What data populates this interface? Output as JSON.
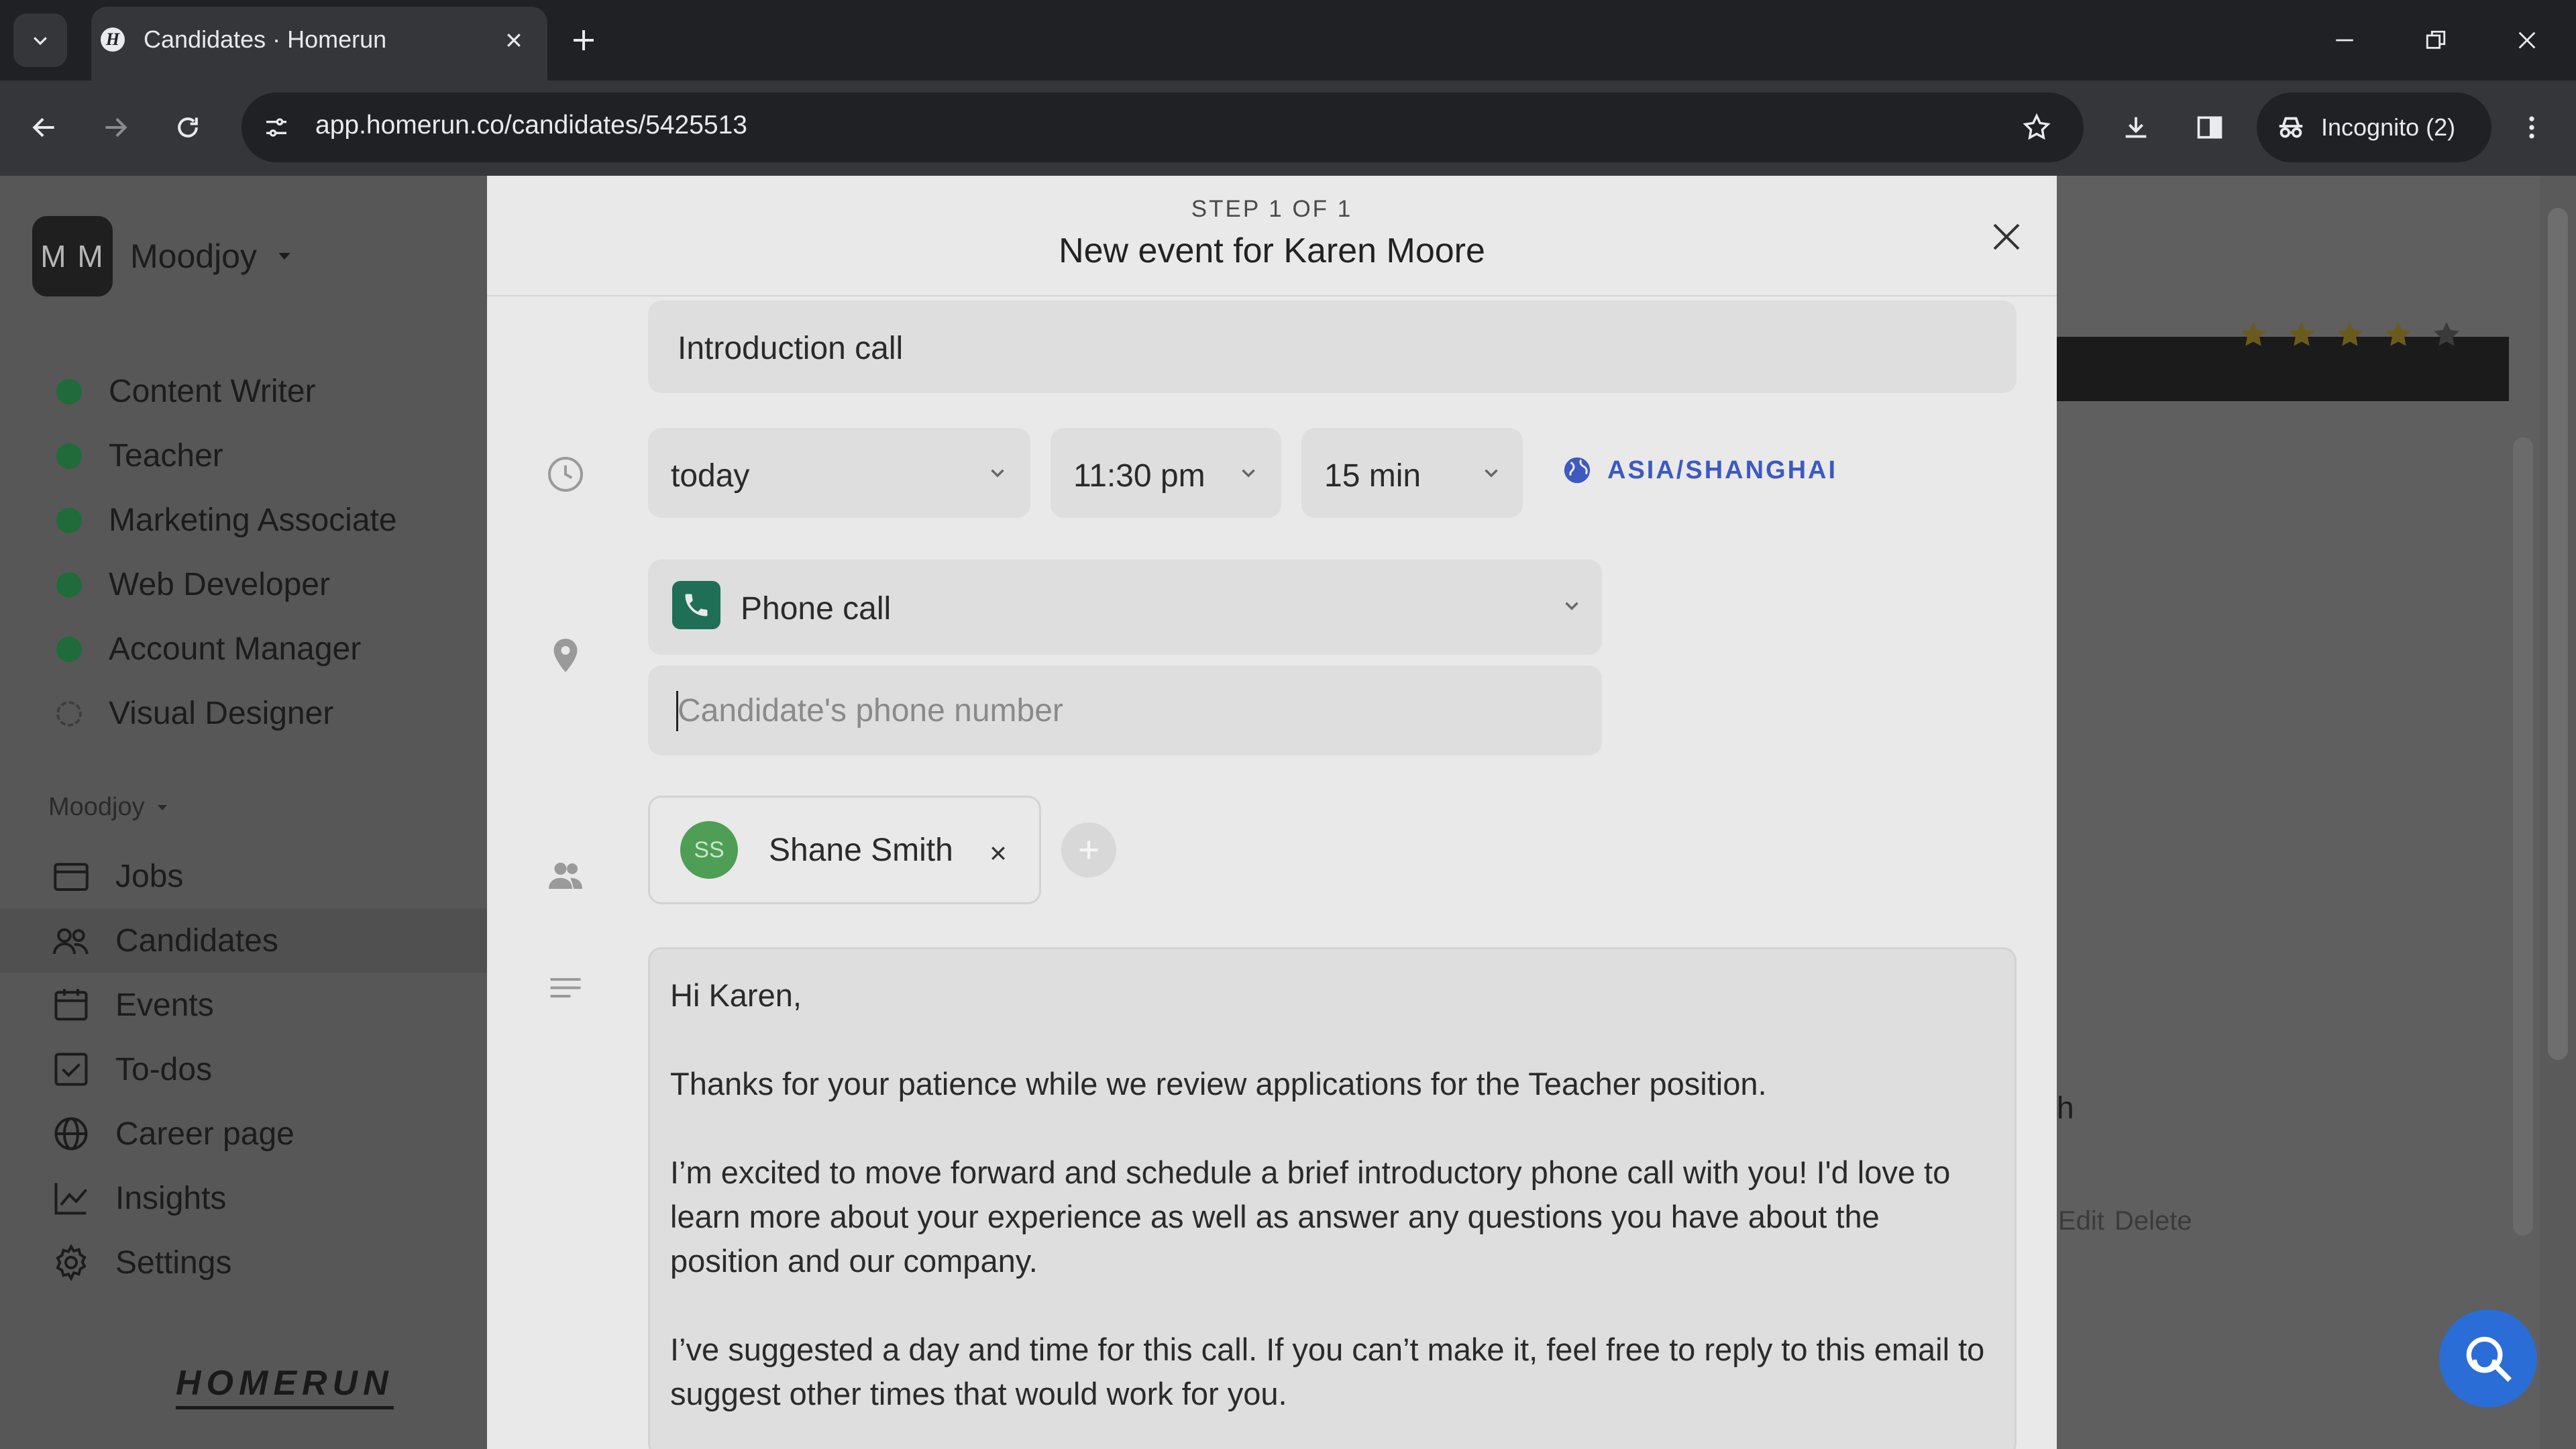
{
  "browser": {
    "tab_title": "Candidates · Homerun",
    "favicon_letter": "H",
    "url": "app.homerun.co/candidates/5425513",
    "incognito_label": "Incognito (2)"
  },
  "sidebar": {
    "workspace_initials": "M M",
    "workspace_name": "Moodjoy",
    "jobs": [
      {
        "label": "Content Writer",
        "status": "active"
      },
      {
        "label": "Teacher",
        "status": "active"
      },
      {
        "label": "Marketing Associate",
        "status": "active"
      },
      {
        "label": "Web Developer",
        "status": "active"
      },
      {
        "label": "Account Manager",
        "status": "active"
      },
      {
        "label": "Visual Designer",
        "status": "draft"
      }
    ],
    "section_label": "Moodjoy",
    "nav": [
      {
        "label": "Jobs",
        "icon": "briefcase-icon"
      },
      {
        "label": "Candidates",
        "icon": "people-icon"
      },
      {
        "label": "Events",
        "icon": "calendar-icon"
      },
      {
        "label": "To-dos",
        "icon": "checkbox-icon"
      },
      {
        "label": "Career page",
        "icon": "globe-icon"
      },
      {
        "label": "Insights",
        "icon": "chart-icon"
      },
      {
        "label": "Settings",
        "icon": "gear-icon"
      }
    ],
    "active_nav": "Candidates",
    "logo_text": "HOMERUN"
  },
  "background_page": {
    "rating_stars": 4,
    "partial_text": "h",
    "edit_label": "Edit",
    "delete_label": "Delete"
  },
  "modal": {
    "step_label": "STEP 1 OF 1",
    "title": "New event for Karen Moore",
    "event_name": "Introduction call",
    "date": "today",
    "time": "11:30 pm",
    "duration": "15 min",
    "timezone": "ASIA/SHANGHAI",
    "location_type": "Phone call",
    "phone_placeholder": "Candidate's phone number",
    "phone_value": "",
    "attendee": {
      "initials": "SS",
      "name": "Shane Smith"
    },
    "message": [
      "Hi Karen,",
      "Thanks for your patience while we review applications for the Teacher position.",
      "I’m excited to move forward and schedule a brief introductory phone call with you! I'd love to learn more about your experience as well as answer any questions you have about the position and our company.",
      "I’ve suggested a day and time for this call. If you can’t make it, feel free to reply to this email to suggest other times that would work for you."
    ]
  },
  "colors": {
    "accent_blue": "#3e59c0",
    "job_active": "#1f6b3a",
    "phone_icon_bg": "#1f6e56",
    "attendee_avatar": "#4e9e55",
    "help_button": "#2b6dd6"
  }
}
